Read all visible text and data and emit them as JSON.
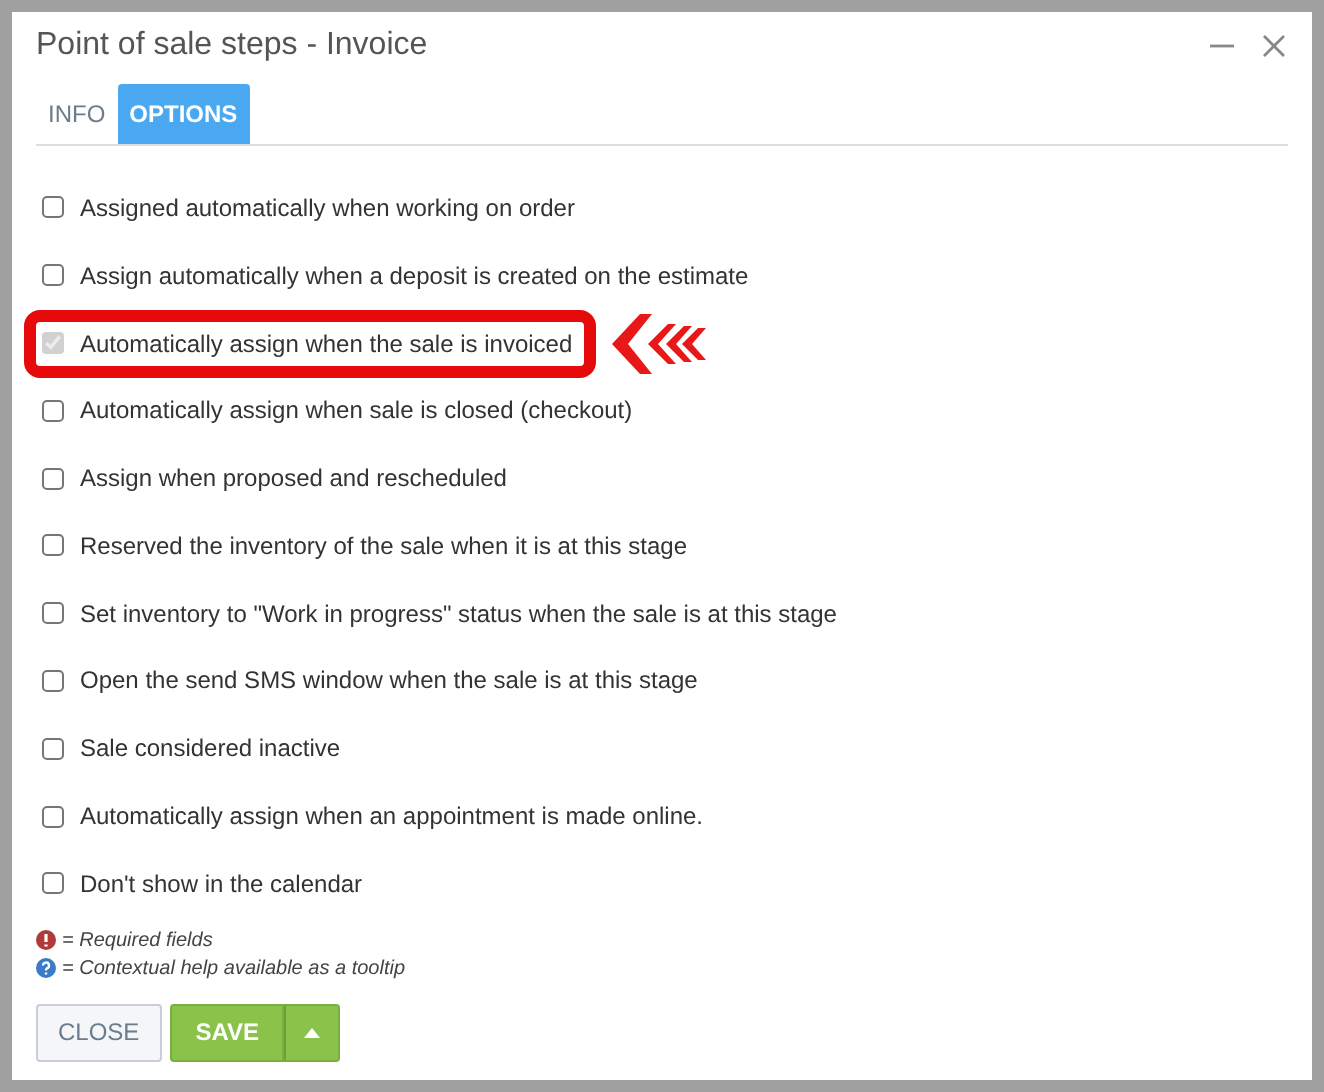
{
  "window": {
    "title": "Point of sale steps - Invoice"
  },
  "tabs": [
    {
      "label": "INFO",
      "selected": false
    },
    {
      "label": "OPTIONS",
      "selected": true
    }
  ],
  "options": [
    {
      "label": "Assigned automatically when working on order",
      "checked": false,
      "disabled": false,
      "highlighted": false
    },
    {
      "label": "Assign automatically when a deposit is created on the estimate",
      "checked": false,
      "disabled": false,
      "highlighted": false
    },
    {
      "label": "Automatically assign when the sale is invoiced",
      "checked": true,
      "disabled": true,
      "highlighted": true
    },
    {
      "label": "Automatically assign when sale is closed (checkout)",
      "checked": false,
      "disabled": false,
      "highlighted": false
    },
    {
      "label": "Assign when proposed and rescheduled",
      "checked": false,
      "disabled": false,
      "highlighted": false
    },
    {
      "label": "Reserved the inventory of the sale when it is at this stage",
      "checked": false,
      "disabled": false,
      "highlighted": false
    },
    {
      "label": "Set inventory to \"Work in progress\" status when the sale is at this stage",
      "checked": false,
      "disabled": false,
      "highlighted": false
    },
    {
      "label": "Open the send SMS window when the sale is at this stage",
      "checked": false,
      "disabled": false,
      "highlighted": false
    },
    {
      "label": "Sale considered inactive",
      "checked": false,
      "disabled": false,
      "highlighted": false
    },
    {
      "label": "Automatically assign when an appointment is made online.",
      "checked": false,
      "disabled": false,
      "highlighted": false
    },
    {
      "label": "Don't show in the calendar",
      "checked": false,
      "disabled": false,
      "highlighted": false
    }
  ],
  "legend": [
    {
      "kind": "required",
      "text": "= Required fields"
    },
    {
      "kind": "help",
      "text": "= Contextual help available as a tooltip"
    }
  ],
  "buttons": {
    "close": "CLOSE",
    "save": "SAVE"
  }
}
